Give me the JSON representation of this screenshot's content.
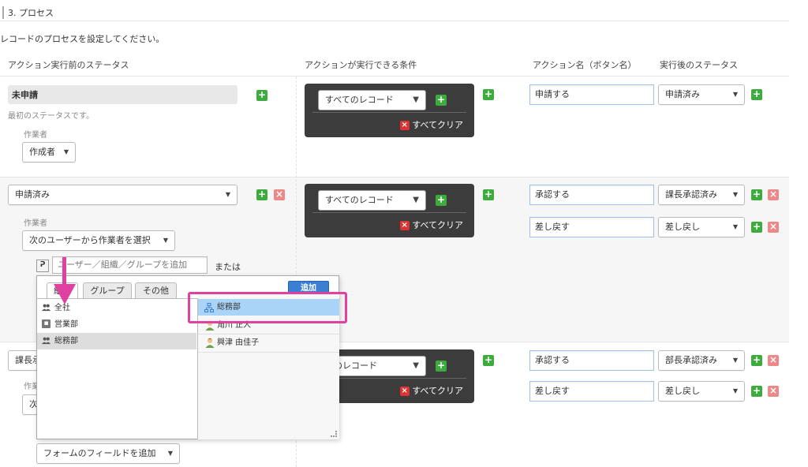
{
  "section": {
    "title": "3. プロセス",
    "description": "レコードのプロセスを設定してください。"
  },
  "columns": {
    "before": "アクション実行前のステータス",
    "condition": "アクションが実行できる条件",
    "action_name": "アクション名（ボタン名）",
    "after": "実行後のステータス"
  },
  "rows": [
    {
      "status": "未申請",
      "note": "最初のステータスです。",
      "assignee_label": "作業者",
      "assignee": "作成者",
      "condition": "すべてのレコード",
      "clear": "すべてクリア",
      "actions": [
        {
          "name": "申請する",
          "after": "申請済み"
        }
      ]
    },
    {
      "status": "申請済み",
      "assignee_label": "作業者",
      "assignee": "次のユーザーから作業者を選択",
      "user_placeholder": "ユーザー／組織／グループを追加",
      "or": "または",
      "condition": "すべてのレコード",
      "clear": "すべてクリア",
      "actions": [
        {
          "name": "承認する",
          "after": "課長承認済み"
        },
        {
          "name": "差し戻す",
          "after": "差し戻し"
        }
      ]
    },
    {
      "status": "課長承",
      "assignee_label": "作業",
      "assignee": "次",
      "condition": "てのレコード",
      "clear": "すべてクリア",
      "actions": [
        {
          "name": "承認する",
          "after": "部長承認済み"
        },
        {
          "name": "差し戻す",
          "after": "差し戻し"
        }
      ],
      "field_add": "フォームのフィールドを追加"
    }
  ],
  "picker": {
    "tabs": [
      "組織",
      "グループ",
      "その他"
    ],
    "add_button": "追加",
    "tree": [
      {
        "label": "全社",
        "icon": "people-icon"
      },
      {
        "label": "営業部",
        "icon": "collapsed-node-icon"
      },
      {
        "label": "総務部",
        "icon": "people-icon",
        "selected": true
      }
    ],
    "users": [
      {
        "label": "総務部",
        "icon": "org-icon",
        "highlighted": true
      },
      {
        "label": "角川 正人",
        "icon": "user-icon"
      },
      {
        "label": "興津 由佳子",
        "icon": "user-icon"
      }
    ]
  },
  "colors": {
    "green": "#3dab3d",
    "dark_panel": "#3c3c3c",
    "highlight": "#e040a0",
    "blue": "#3b7fd3"
  }
}
